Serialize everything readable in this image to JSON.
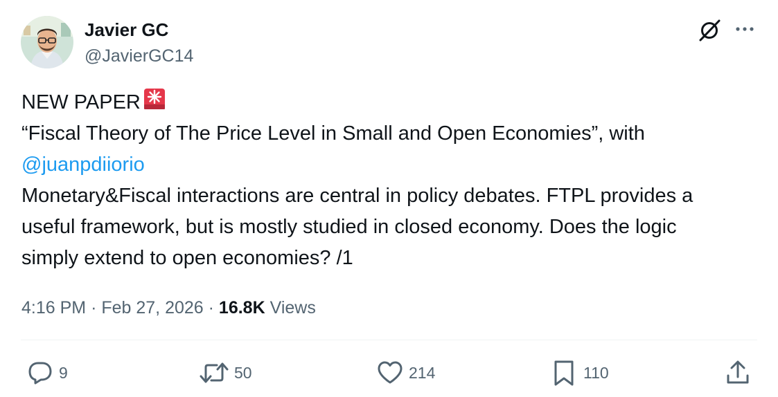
{
  "author": {
    "display_name": "Javier GC",
    "handle": "@JavierGC14",
    "avatar_icon": "avatar-portrait"
  },
  "header": {
    "grok_icon": "grok-icon",
    "more_icon": "more-horizontal-icon"
  },
  "tweet": {
    "line1": "NEW PAPER",
    "line1_emoji": "rotating-light-icon",
    "line2": "“Fiscal Theory of The Price Level in Small and Open Economies”, with",
    "mention": "@juanpdiiorio",
    "line4": "Monetary&Fiscal interactions are central in policy debates. FTPL provides a",
    "line5": "useful framework, but is mostly studied in closed economy. Does the logic",
    "line6": "simply extend to open economies? /1"
  },
  "meta": {
    "time": "4:16 PM",
    "separator": "·",
    "date": "Feb 27, 2026",
    "views_count": "16.8K",
    "views_label": "Views"
  },
  "actions": {
    "replies": "9",
    "reposts": "50",
    "likes": "214",
    "bookmarks": "110"
  },
  "colors": {
    "text": "#0f1419",
    "secondary": "#536471",
    "link": "#1d9bf0",
    "divider": "#eff3f4",
    "alarm": "#e5374a"
  }
}
